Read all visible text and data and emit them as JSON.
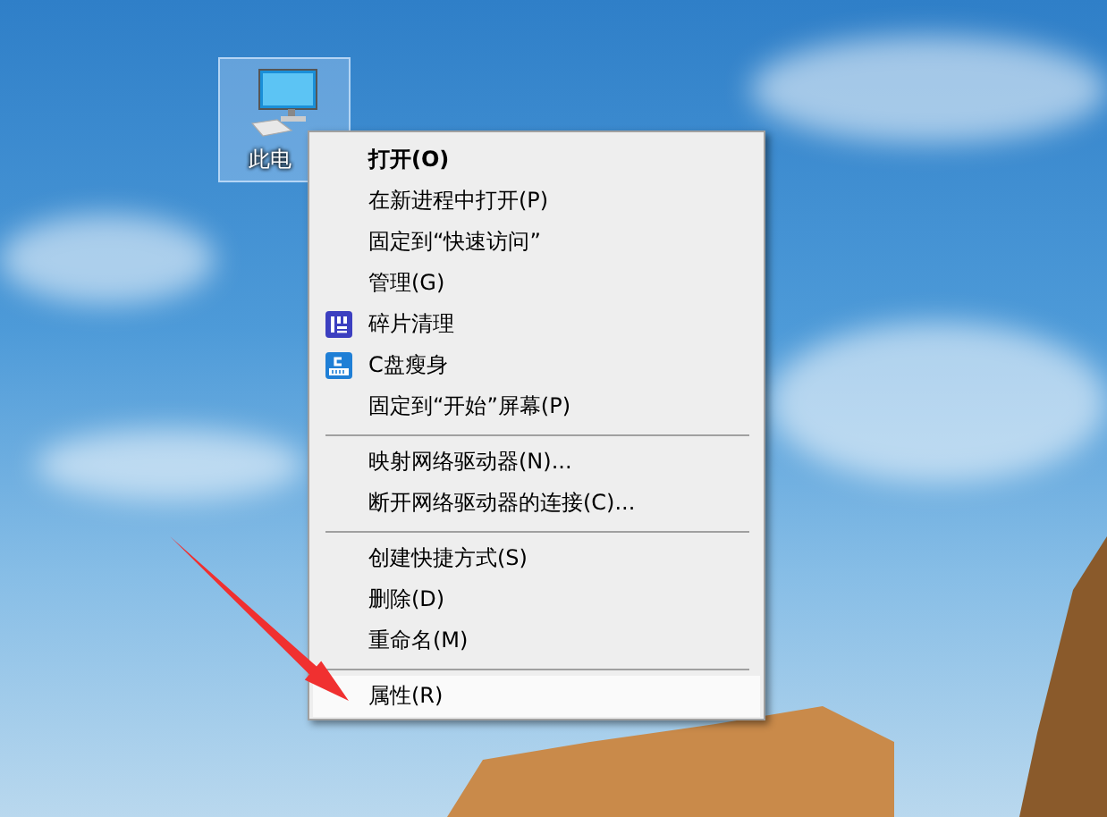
{
  "desktop_icon": {
    "label": "此电",
    "selected": true
  },
  "context_menu": {
    "items": [
      {
        "kind": "item",
        "label": "打开(O)",
        "bold": true,
        "selected": false
      },
      {
        "kind": "item",
        "label": "在新进程中打开(P)",
        "selected": false
      },
      {
        "kind": "item",
        "label": "固定到“快速访问”",
        "selected": false
      },
      {
        "kind": "item",
        "label": "管理(G)",
        "selected": false
      },
      {
        "kind": "griditem",
        "label": "碎片清理",
        "selected": false
      },
      {
        "kind": "diskitem",
        "label": "C盘瘦身",
        "selected": false
      },
      {
        "kind": "item",
        "label": "固定到“开始”屏幕(P)",
        "selected": false
      },
      {
        "kind": "separator"
      },
      {
        "kind": "item",
        "label": "映射网络驱动器(N)...",
        "selected": false
      },
      {
        "kind": "item",
        "label": "断开网络驱动器的连接(C)...",
        "selected": false
      },
      {
        "kind": "separator"
      },
      {
        "kind": "item",
        "label": "创建快捷方式(S)",
        "selected": false
      },
      {
        "kind": "item",
        "label": "删除(D)",
        "selected": false
      },
      {
        "kind": "item",
        "label": "重命名(M)",
        "selected": false
      },
      {
        "kind": "separator"
      },
      {
        "kind": "item",
        "label": "属性(R)",
        "selected": true
      }
    ]
  }
}
